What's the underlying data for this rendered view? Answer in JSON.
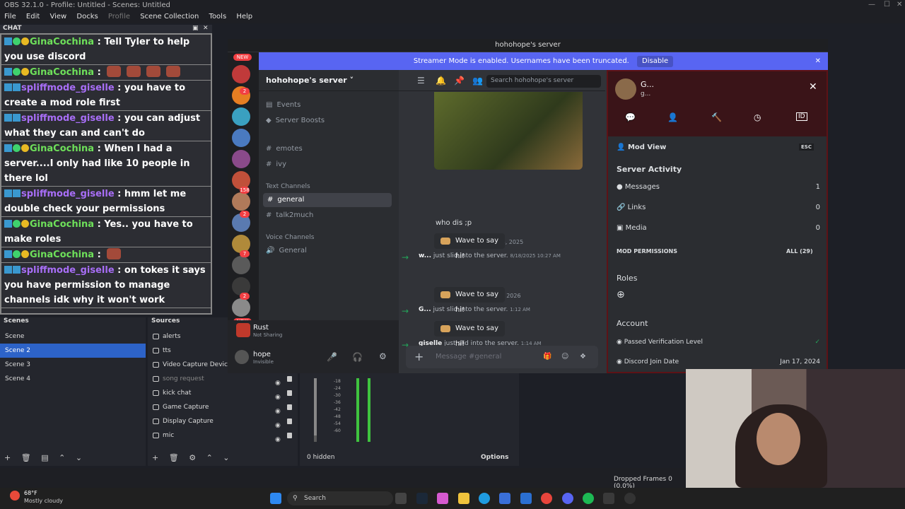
{
  "obs": {
    "title": "OBS 32.1.0 - Profile: Untitled - Scenes: Untitled",
    "menu": [
      "File",
      "Edit",
      "View",
      "Docks",
      "Profile",
      "Scene Collection",
      "Tools",
      "Help"
    ],
    "chat_dock_title": "CHAT",
    "scenes_title": "Scenes",
    "sources_title": "Sources",
    "scenes": [
      "Scene",
      "Scene 2",
      "Scene 3",
      "Scene 4"
    ],
    "selected_scene": "Scene 2",
    "sources": [
      "alerts",
      "tts",
      "Video Capture Device",
      "song request",
      "kick chat",
      "Game Capture",
      "Display Capture",
      "mic"
    ],
    "mixer_labels": [
      "-18",
      "-24",
      "-30",
      "-36",
      "-42",
      "-48",
      "-54",
      "-60"
    ],
    "hidden_label": "0 hidden",
    "options_label": "Options",
    "dropped_frames": "Dropped Frames 0 (0.0%)"
  },
  "chat": [
    {
      "user": "GinaCochina",
      "color": "green",
      "text": " : Tell Tyler to help you use discord",
      "emotes": 0
    },
    {
      "user": "GinaCochina",
      "color": "green",
      "text": " : ",
      "emotes": 4
    },
    {
      "user": "spliffmode_giselle",
      "color": "purple",
      "text": " : you have to create a mod role first",
      "emotes": 0
    },
    {
      "user": "spliffmode_giselle",
      "color": "purple",
      "text": " : you can adjust what they can and can't do",
      "emotes": 0
    },
    {
      "user": "GinaCochina",
      "color": "green",
      "text": " : When I had a server....I only had like 10 people in there lol",
      "emotes": 0
    },
    {
      "user": "spliffmode_giselle",
      "color": "purple",
      "text": " : hmm let me double check your permissions",
      "emotes": 0
    },
    {
      "user": "GinaCochina",
      "color": "green",
      "text": " : Yes.. you have to make roles",
      "emotes": 0
    },
    {
      "user": "GinaCochina",
      "color": "green",
      "text": " : ",
      "emotes": 1
    },
    {
      "user": "spliffmode_giselle",
      "color": "purple",
      "text": " : on tokes it says you have permission to manage channels idk why it won't work",
      "emotes": 0
    }
  ],
  "discord": {
    "window_title": "hohohope's server",
    "streamer_mode": "Streamer Mode is enabled. Usernames have been truncated.",
    "disable_label": "Disable",
    "server_name": "hohohope's server",
    "events": "Events",
    "boosts": "Server Boosts",
    "channels_top": [
      "emotes",
      "ivy"
    ],
    "text_category": "Text Channels",
    "text_channels": [
      "general",
      "talk2much"
    ],
    "voice_category": "Voice Channels",
    "voice_channels": [
      "General"
    ],
    "new_badge": "NEW",
    "guild_badges": [
      "2",
      "158",
      "2",
      "7",
      "2"
    ],
    "activity_name": "Rust",
    "activity_status": "Not Sharing",
    "user_name": "hope",
    "user_status": "Invisible",
    "search_placeholder": "Search hohohope's server",
    "message_1": "who dis ;p",
    "date_1": "August 18, 2025",
    "join_1_name": "w...",
    "join_1_text": " just slid into the server. ",
    "join_1_time": "8/18/2025 10:27 AM",
    "date_2": "March 31, 2026",
    "join_2_name": "G...",
    "join_2_text": " just slid into the server. ",
    "join_2_time": "1:12 AM",
    "join_3_name": "giselle",
    "join_3_text": " just slid into the server. ",
    "join_3_time": "1:14 AM",
    "wave_label": "Wave to say hi!",
    "input_placeholder": "Message #general",
    "profile": {
      "name": "G...",
      "sub": "g...",
      "mod_view": "Mod View",
      "esc": "ESC",
      "server_activity": "Server Activity",
      "messages_label": "Messages",
      "messages_value": "1",
      "links_label": "Links",
      "links_value": "0",
      "media_label": "Media",
      "media_value": "0",
      "mod_permissions": "MOD PERMISSIONS",
      "all_label": "ALL (29)",
      "roles": "Roles",
      "account": "Account",
      "verification": "Passed Verification Level",
      "join_label": "Discord Join Date",
      "join_date": "Jan 17, 2024"
    }
  },
  "taskbar": {
    "temp": "68°F",
    "weather": "Mostly cloudy",
    "search": "Search"
  }
}
